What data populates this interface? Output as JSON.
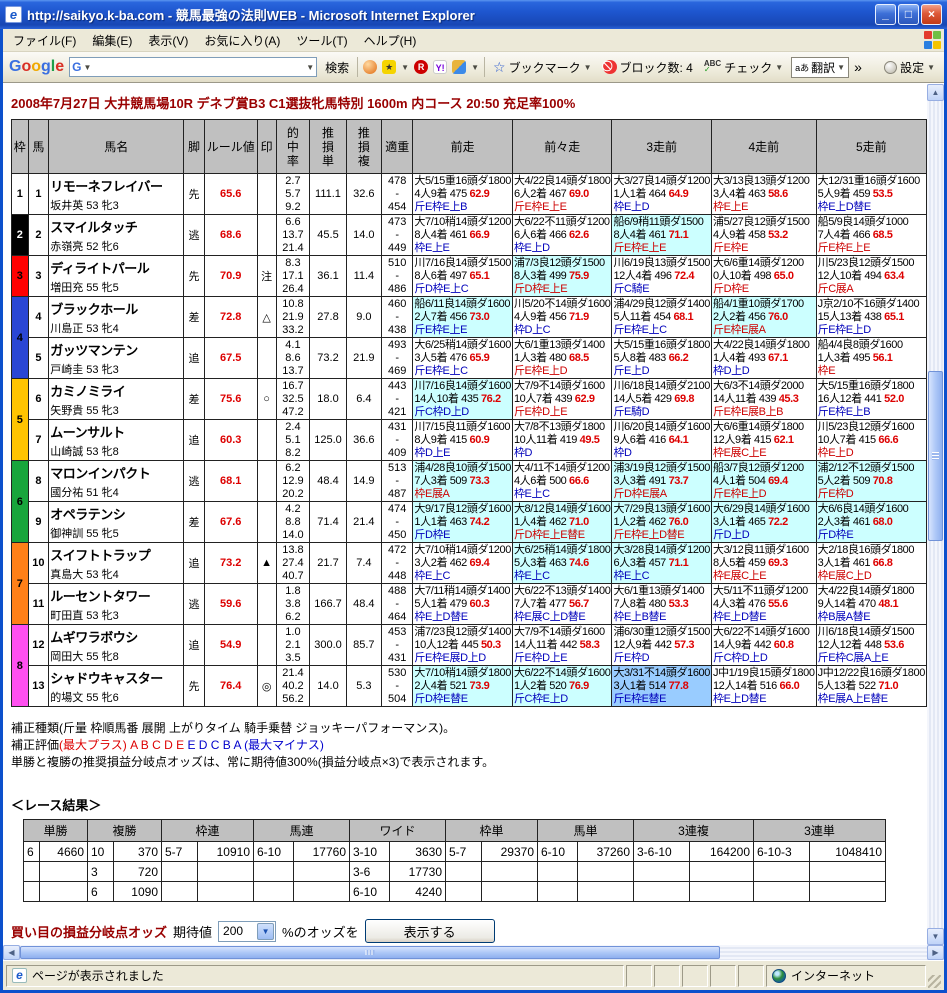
{
  "window": {
    "title": "http://saikyo.k-ba.com - 競馬最強の法則WEB - Microsoft Internet Explorer",
    "menus": [
      "ファイル(F)",
      "編集(E)",
      "表示(V)",
      "お気に入り(A)",
      "ツール(T)",
      "ヘルプ(H)"
    ],
    "status_left": "ページが表示されました",
    "status_right": "インターネット"
  },
  "toolbar": {
    "brand": "Google",
    "search_placeholder": "",
    "search_label": "検索",
    "bookmark_label": "ブックマーク",
    "block_label": "ブロック数: 4",
    "check_label": "チェック",
    "check_abc": "ABC",
    "translate_label": "翻訳",
    "translate_glyph": "aあ",
    "more_glyph": "»",
    "settings_label": "設定"
  },
  "page": {
    "race_title": "2008年7月27日 大井競馬場10R デネブ賞B3 C1選抜牝馬特別 1600m 内コース 20:50 充足率100%",
    "table_headers": [
      "枠",
      "馬",
      "馬名",
      "脚",
      "ルール値",
      "印",
      "的\n中\n率",
      "推\n損\n単",
      "推\n損\n複",
      "適重",
      "前走",
      "前々走",
      "3走前",
      "4走前",
      "5走前"
    ]
  },
  "horses": [
    {
      "frame": {
        "label": "1",
        "span": 1,
        "bg": "#ffffff",
        "fg": "#000000"
      },
      "num": "1",
      "name": "リモーネフレイバー",
      "jockey": "坂井英 53 牝3",
      "leg": "先",
      "rule": "65.6",
      "mark": "",
      "hit": [
        "2.7",
        "5.7",
        "9.2"
      ],
      "loss_win": "111.1",
      "loss_place": "32.6",
      "wt_hi": "478",
      "wt_lo": "454",
      "races": [
        {
          "t": "大5/15重16頭ダ1800",
          "res": "4人9着 475",
          "val": "62.9",
          "corr": "斤E枠E上B",
          "cc": "b",
          "bg": "w"
        },
        {
          "t": "大4/22良14頭ダ1800",
          "res": "6人2着 467",
          "val": "69.0",
          "corr": "斤E枠E上E",
          "cc": "r",
          "bg": "w"
        },
        {
          "t": "大3/27良14頭ダ1200",
          "res": "1人1着 464",
          "val": "64.9",
          "corr": "枠E上D",
          "cc": "b",
          "bg": "w"
        },
        {
          "t": "大3/13良13頭ダ1200",
          "res": "3人4着 463",
          "val": "58.6",
          "corr": "枠E上E",
          "cc": "r",
          "bg": "w"
        },
        {
          "t": "大12/31重16頭ダ1600",
          "res": "5人9着 459",
          "val": "53.5",
          "corr": "枠E上D替E",
          "cc": "b",
          "bg": "w"
        }
      ]
    },
    {
      "frame": {
        "label": "2",
        "span": 1,
        "bg": "#000000",
        "fg": "#ffffff"
      },
      "num": "2",
      "name": "スマイルタッチ",
      "jockey": "赤嶺亮 52 牝6",
      "leg": "逃",
      "rule": "68.6",
      "mark": "",
      "hit": [
        "6.6",
        "13.7",
        "21.4"
      ],
      "loss_win": "45.5",
      "loss_place": "14.0",
      "wt_hi": "473",
      "wt_lo": "449",
      "races": [
        {
          "t": "大7/10稍14頭ダ1200",
          "res": "8人4着 461",
          "val": "66.9",
          "corr": "枠E上E",
          "cc": "b",
          "bg": "w"
        },
        {
          "t": "大6/22不11頭ダ1200",
          "res": "6人6着 466",
          "val": "62.6",
          "corr": "枠E上D",
          "cc": "b",
          "bg": "w"
        },
        {
          "t": "船6/9稍11頭ダ1500",
          "res": "8人4着 461",
          "val": "71.1",
          "corr": "斤E枠E上E",
          "cc": "r",
          "bg": "c"
        },
        {
          "t": "浦5/27良12頭ダ1500",
          "res": "4人9着 458",
          "val": "53.2",
          "corr": "斤E枠E",
          "cc": "r",
          "bg": "w"
        },
        {
          "t": "船5/9良14頭ダ1000",
          "res": "7人4着 466",
          "val": "68.5",
          "corr": "斤E枠E上E",
          "cc": "r",
          "bg": "w"
        }
      ]
    },
    {
      "frame": {
        "label": "3",
        "span": 1,
        "bg": "#ff0000",
        "fg": "#000000"
      },
      "num": "3",
      "name": "ディライトパール",
      "jockey": "増田充 55 牝5",
      "leg": "先",
      "rule": "70.9",
      "mark": "注",
      "hit": [
        "8.3",
        "17.1",
        "26.4"
      ],
      "loss_win": "36.1",
      "loss_place": "11.4",
      "wt_hi": "510",
      "wt_lo": "486",
      "races": [
        {
          "t": "川7/16良14頭ダ1500",
          "res": "8人6着 497",
          "val": "65.1",
          "corr": "斤D枠E上C",
          "cc": "b",
          "bg": "w"
        },
        {
          "t": "浦7/3良12頭ダ1500",
          "res": "8人3着 499",
          "val": "75.9",
          "corr": "斤D枠E上E",
          "cc": "r",
          "bg": "c"
        },
        {
          "t": "川6/19良13頭ダ1500",
          "res": "12人4着 496",
          "val": "72.4",
          "corr": "斤C騎E",
          "cc": "b",
          "bg": "w"
        },
        {
          "t": "大6/6重14頭ダ1200",
          "res": "0人10着 498",
          "val": "65.0",
          "corr": "斤D枠E",
          "cc": "r",
          "bg": "w"
        },
        {
          "t": "川5/23良12頭ダ1500",
          "res": "12人10着 494",
          "val": "63.4",
          "corr": "斤C展A",
          "cc": "r",
          "bg": "w"
        }
      ]
    },
    {
      "frame": {
        "label": "4",
        "span": 2,
        "bg": "#2a46d4",
        "fg": "#000000"
      },
      "num": "4",
      "name": "ブラックホール",
      "jockey": "川島正 53 牝4",
      "leg": "差",
      "rule": "72.8",
      "mark": "△",
      "hit": [
        "10.8",
        "21.9",
        "33.2"
      ],
      "loss_win": "27.8",
      "loss_place": "9.0",
      "wt_hi": "460",
      "wt_lo": "438",
      "races": [
        {
          "t": "船6/11良14頭ダ1600",
          "res": "2人7着 456",
          "val": "73.0",
          "corr": "斤E枠E上E",
          "cc": "b",
          "bg": "c"
        },
        {
          "t": "川5/20不14頭ダ1600",
          "res": "4人9着 456",
          "val": "71.9",
          "corr": "枠D上C",
          "cc": "b",
          "bg": "w"
        },
        {
          "t": "浦4/29良12頭ダ1400",
          "res": "5人11着 454",
          "val": "68.1",
          "corr": "斤E枠E上C",
          "cc": "b",
          "bg": "w"
        },
        {
          "t": "船4/1重10頭ダ1700",
          "res": "2人2着 456",
          "val": "76.0",
          "corr": "斤E枠E展A",
          "cc": "r",
          "bg": "c"
        },
        {
          "t": "J京2/10不16頭ダ1400",
          "res": "15人13着 438",
          "val": "65.1",
          "corr": "斤E枠E上D",
          "cc": "b",
          "bg": "w"
        }
      ]
    },
    {
      "num": "5",
      "name": "ガッツマンテン",
      "jockey": "戸崎圭 53 牝3",
      "leg": "追",
      "rule": "67.5",
      "mark": "",
      "hit": [
        "4.1",
        "8.6",
        "13.7"
      ],
      "loss_win": "73.2",
      "loss_place": "21.9",
      "wt_hi": "493",
      "wt_lo": "469",
      "races": [
        {
          "t": "大6/25稍14頭ダ1600",
          "res": "3人5着 476",
          "val": "65.9",
          "corr": "斤E枠E上C",
          "cc": "b",
          "bg": "w"
        },
        {
          "t": "大6/1重13頭ダ1400",
          "res": "1人3着 480",
          "val": "68.5",
          "corr": "斤E枠E上D",
          "cc": "r",
          "bg": "w"
        },
        {
          "t": "大5/15重16頭ダ1800",
          "res": "5人8着 483",
          "val": "66.2",
          "corr": "斤E上D",
          "cc": "b",
          "bg": "w"
        },
        {
          "t": "大4/22良14頭ダ1800",
          "res": "1人4着 493",
          "val": "67.1",
          "corr": "枠D上D",
          "cc": "b",
          "bg": "w"
        },
        {
          "t": "船4/4良8頭ダ1600",
          "res": "1人3着 495",
          "val": "56.1",
          "corr": "枠E",
          "cc": "r",
          "bg": "w"
        }
      ]
    },
    {
      "frame": {
        "label": "5",
        "span": 2,
        "bg": "#ffc400",
        "fg": "#000000"
      },
      "num": "6",
      "name": "カミノミライ",
      "jockey": "矢野貴 55 牝3",
      "leg": "差",
      "rule": "75.6",
      "mark": "○",
      "hit": [
        "16.7",
        "32.5",
        "47.2"
      ],
      "loss_win": "18.0",
      "loss_place": "6.4",
      "wt_hi": "443",
      "wt_lo": "421",
      "races": [
        {
          "t": "川7/16良14頭ダ1600",
          "res": "14人10着 435",
          "val": "76.2",
          "corr": "斤C枠D上D",
          "cc": "b",
          "bg": "c"
        },
        {
          "t": "大7/9不14頭ダ1600",
          "res": "10人7着 439",
          "val": "62.9",
          "corr": "斤E枠D上E",
          "cc": "r",
          "bg": "w"
        },
        {
          "t": "川6/18良14頭ダ2100",
          "res": "14人5着 429",
          "val": "69.8",
          "corr": "斤E騎D",
          "cc": "b",
          "bg": "w"
        },
        {
          "t": "大6/3不14頭ダ2000",
          "res": "14人11着 439",
          "val": "45.3",
          "corr": "斤E枠E展B上B",
          "cc": "r",
          "bg": "w"
        },
        {
          "t": "大5/15重16頭ダ1800",
          "res": "16人12着 441",
          "val": "52.0",
          "corr": "斤E枠E上B",
          "cc": "b",
          "bg": "w"
        }
      ]
    },
    {
      "num": "7",
      "name": "ムーンサルト",
      "jockey": "山崎誠 53 牝8",
      "leg": "追",
      "rule": "60.3",
      "mark": "",
      "hit": [
        "2.4",
        "5.1",
        "8.2"
      ],
      "loss_win": "125.0",
      "loss_place": "36.6",
      "wt_hi": "431",
      "wt_lo": "409",
      "races": [
        {
          "t": "川7/15良11頭ダ1600",
          "res": "8人9着 415",
          "val": "60.9",
          "corr": "枠D上E",
          "cc": "b",
          "bg": "w"
        },
        {
          "t": "大7/8不13頭ダ1800",
          "res": "10人11着 419",
          "val": "49.5",
          "corr": "枠D",
          "cc": "b",
          "bg": "w"
        },
        {
          "t": "川6/20良14頭ダ1600",
          "res": "9人6着 416",
          "val": "64.1",
          "corr": "枠D",
          "cc": "b",
          "bg": "w"
        },
        {
          "t": "大6/6重14頭ダ1800",
          "res": "12人9着 415",
          "val": "62.1",
          "corr": "枠E展C上E",
          "cc": "r",
          "bg": "w"
        },
        {
          "t": "川5/23良12頭ダ1600",
          "res": "10人7着 415",
          "val": "66.6",
          "corr": "枠E上D",
          "cc": "r",
          "bg": "w"
        }
      ]
    },
    {
      "frame": {
        "label": "6",
        "span": 2,
        "bg": "#18a53c",
        "fg": "#000000"
      },
      "num": "8",
      "name": "マロンインパクト",
      "jockey": "國分祐 51 牝4",
      "leg": "逃",
      "rule": "68.1",
      "mark": "",
      "hit": [
        "6.2",
        "12.9",
        "20.2"
      ],
      "loss_win": "48.4",
      "loss_place": "14.9",
      "wt_hi": "513",
      "wt_lo": "487",
      "races": [
        {
          "t": "浦4/28良10頭ダ1500",
          "res": "7人3着 509",
          "val": "73.3",
          "corr": "枠E展A",
          "cc": "r",
          "bg": "c"
        },
        {
          "t": "大4/11不14頭ダ1200",
          "res": "4人6着 500",
          "val": "66.6",
          "corr": "枠E上C",
          "cc": "b",
          "bg": "w"
        },
        {
          "t": "浦3/19良12頭ダ1500",
          "res": "3人3着 491",
          "val": "73.7",
          "corr": "斤D枠E展A",
          "cc": "r",
          "bg": "c"
        },
        {
          "t": "船3/7良12頭ダ1200",
          "res": "4人1着 504",
          "val": "69.4",
          "corr": "斤E枠E上D",
          "cc": "r",
          "bg": "c"
        },
        {
          "t": "浦2/12不12頭ダ1500",
          "res": "5人2着 509",
          "val": "70.8",
          "corr": "斤E枠D",
          "cc": "r",
          "bg": "c"
        }
      ]
    },
    {
      "num": "9",
      "name": "オペラテンシ",
      "jockey": "御神訓 55 牝5",
      "leg": "差",
      "rule": "67.6",
      "mark": "",
      "hit": [
        "4.2",
        "8.8",
        "14.0"
      ],
      "loss_win": "71.4",
      "loss_place": "21.4",
      "wt_hi": "474",
      "wt_lo": "450",
      "races": [
        {
          "t": "大9/17良12頭ダ1600",
          "res": "1人1着 463",
          "val": "74.2",
          "corr": "斤D枠E",
          "cc": "b",
          "bg": "c"
        },
        {
          "t": "大8/12良14頭ダ1600",
          "res": "1人4着 462",
          "val": "71.0",
          "corr": "斤D枠E上E替E",
          "cc": "r",
          "bg": "c"
        },
        {
          "t": "大7/29良13頭ダ1600",
          "res": "1人2着 462",
          "val": "76.0",
          "corr": "斤E枠E上D替E",
          "cc": "r",
          "bg": "c"
        },
        {
          "t": "大6/29良14頭ダ1600",
          "res": "3人1着 465",
          "val": "72.2",
          "corr": "斤D上D",
          "cc": "b",
          "bg": "c"
        },
        {
          "t": "大6/6良14頭ダ1600",
          "res": "2人3着 461",
          "val": "68.0",
          "corr": "斤D枠E",
          "cc": "b",
          "bg": "c"
        }
      ]
    },
    {
      "frame": {
        "label": "7",
        "span": 2,
        "bg": "#ff8018",
        "fg": "#000000"
      },
      "num": "10",
      "name": "スイフトトラップ",
      "jockey": "真島大 53 牝4",
      "leg": "追",
      "rule": "73.2",
      "mark": "▲",
      "hit": [
        "13.8",
        "27.4",
        "40.7"
      ],
      "loss_win": "21.7",
      "loss_place": "7.4",
      "wt_hi": "472",
      "wt_lo": "448",
      "races": [
        {
          "t": "大7/10稍14頭ダ1200",
          "res": "3人2着 462",
          "val": "69.4",
          "corr": "枠E上C",
          "cc": "b",
          "bg": "w"
        },
        {
          "t": "大6/25稍14頭ダ1800",
          "res": "5人3着 463",
          "val": "74.6",
          "corr": "枠E上C",
          "cc": "b",
          "bg": "c"
        },
        {
          "t": "大3/28良14頭ダ1200",
          "res": "6人3着 457",
          "val": "71.1",
          "corr": "枠E上C",
          "cc": "b",
          "bg": "c"
        },
        {
          "t": "大3/12良11頭ダ1600",
          "res": "8人5着 459",
          "val": "69.3",
          "corr": "枠E展C上E",
          "cc": "r",
          "bg": "w"
        },
        {
          "t": "大2/18良16頭ダ1800",
          "res": "3人1着 461",
          "val": "66.8",
          "corr": "枠E展C上D",
          "cc": "r",
          "bg": "w"
        }
      ]
    },
    {
      "num": "11",
      "name": "ルーセントタワー",
      "jockey": "町田直 53 牝3",
      "leg": "逃",
      "rule": "59.6",
      "mark": "",
      "hit": [
        "1.8",
        "3.8",
        "6.2"
      ],
      "loss_win": "166.7",
      "loss_place": "48.4",
      "wt_hi": "488",
      "wt_lo": "464",
      "races": [
        {
          "t": "大7/11稍14頭ダ1400",
          "res": "5人1着 479",
          "val": "60.3",
          "corr": "枠E上D替E",
          "cc": "b",
          "bg": "w"
        },
        {
          "t": "大6/22不13頭ダ1400",
          "res": "7人7着 477",
          "val": "56.7",
          "corr": "枠E展C上D替E",
          "cc": "b",
          "bg": "w"
        },
        {
          "t": "大6/1重13頭ダ1400",
          "res": "7人8着 480",
          "val": "53.3",
          "corr": "枠E上B替E",
          "cc": "b",
          "bg": "w"
        },
        {
          "t": "大5/11不11頭ダ1200",
          "res": "4人3着 476",
          "val": "55.6",
          "corr": "枠E上D替E",
          "cc": "b",
          "bg": "w"
        },
        {
          "t": "大4/22良14頭ダ1800",
          "res": "9人14着 470",
          "val": "48.1",
          "corr": "枠B展A替E",
          "cc": "b",
          "bg": "w"
        }
      ]
    },
    {
      "frame": {
        "label": "8",
        "span": 2,
        "bg": "#ff50f0",
        "fg": "#000000"
      },
      "num": "12",
      "name": "ムギワラボウシ",
      "jockey": "岡田大 55 牝8",
      "leg": "追",
      "rule": "54.9",
      "mark": "",
      "hit": [
        "1.0",
        "2.1",
        "3.5"
      ],
      "loss_win": "300.0",
      "loss_place": "85.7",
      "wt_hi": "453",
      "wt_lo": "431",
      "races": [
        {
          "t": "浦7/23良12頭ダ1400",
          "res": "10人12着 445",
          "val": "50.3",
          "corr": "斤E枠E展D上D",
          "cc": "b",
          "bg": "w"
        },
        {
          "t": "大7/9不14頭ダ1600",
          "res": "14人11着 442",
          "val": "58.3",
          "corr": "斤E枠D上E",
          "cc": "b",
          "bg": "w"
        },
        {
          "t": "浦6/30重12頭ダ1500",
          "res": "12人9着 442",
          "val": "57.3",
          "corr": "斤E枠D",
          "cc": "b",
          "bg": "w"
        },
        {
          "t": "大6/22不14頭ダ1600",
          "res": "14人9着 442",
          "val": "60.8",
          "corr": "斤C枠D上D",
          "cc": "b",
          "bg": "w"
        },
        {
          "t": "川6/18良14頭ダ1500",
          "res": "12人12着 448",
          "val": "53.6",
          "corr": "斤E枠C展A上E",
          "cc": "b",
          "bg": "w"
        }
      ]
    },
    {
      "num": "13",
      "name": "シャドウキャスター",
      "jockey": "的場文 55 牝6",
      "leg": "先",
      "rule": "76.4",
      "mark": "◎",
      "hit": [
        "21.4",
        "40.2",
        "56.2"
      ],
      "loss_win": "14.0",
      "loss_place": "5.3",
      "wt_hi": "530",
      "wt_lo": "504",
      "races": [
        {
          "t": "大7/10稍14頭ダ1800",
          "res": "2人4着 521",
          "val": "73.9",
          "corr": "斤D枠E替E",
          "cc": "b",
          "bg": "c"
        },
        {
          "t": "大6/22不14頭ダ1600",
          "res": "1人2着 520",
          "val": "76.9",
          "corr": "斤C枠E上D",
          "cc": "b",
          "bg": "c"
        },
        {
          "t": "大3/31不14頭ダ1600",
          "res": "3人1着 514",
          "val": "77.8",
          "corr": "斤E枠E替E",
          "cc": "b",
          "bg": "h"
        },
        {
          "t": "J中1/19良15頭ダ1800",
          "res": "12人14着 516",
          "val": "66.0",
          "corr": "枠E上D替E",
          "cc": "b",
          "bg": "w"
        },
        {
          "t": "J中12/22良16頭ダ1800",
          "res": "5人13着 522",
          "val": "71.0",
          "corr": "枠E展A上E替E",
          "cc": "b",
          "bg": "w"
        }
      ]
    }
  ],
  "notes": {
    "line1": "補正種類(斤量 枠順馬番 展開 上がりタイム 騎手乗替 ジョッキーパフォーマンス)。",
    "line2_black": "補正評価",
    "line2_red": "(最大プラス)  A  B  C  D  E",
    "line2_blue": "  E  D  C  B  A  (最大マイナス)",
    "line3": "単勝と複勝の推奨損益分岐点オッズは、常に期待値300%(損益分岐点×3)で表示されます。"
  },
  "results": {
    "title": "＜レース結果＞",
    "headers": [
      "単勝",
      "複勝",
      "枠連",
      "馬連",
      "ワイド",
      "枠単",
      "馬単",
      "3連複",
      "3連単"
    ],
    "rows": [
      [
        [
          "6",
          "4660"
        ],
        [
          "10",
          "370"
        ],
        [
          "5-7",
          "10910"
        ],
        [
          "6-10",
          "17760"
        ],
        [
          "3-10",
          "3630"
        ],
        [
          "5-7",
          "29370"
        ],
        [
          "6-10",
          "37260"
        ],
        [
          "3-6-10",
          "164200"
        ],
        [
          "6-10-3",
          "1048410"
        ]
      ],
      [
        [
          "",
          ""
        ],
        [
          "3",
          "720"
        ],
        [
          "",
          ""
        ],
        [
          "",
          ""
        ],
        [
          "3-6",
          "17730"
        ],
        [
          "",
          ""
        ],
        [
          "",
          ""
        ],
        [
          "",
          ""
        ],
        [
          "",
          ""
        ]
      ],
      [
        [
          "",
          ""
        ],
        [
          "6",
          "1090"
        ],
        [
          "",
          ""
        ],
        [
          "",
          ""
        ],
        [
          "6-10",
          "4240"
        ],
        [
          "",
          ""
        ],
        [
          "",
          ""
        ],
        [
          "",
          ""
        ],
        [
          "",
          ""
        ]
      ]
    ]
  },
  "controls": {
    "label": "買い目の損益分岐点オッズ",
    "pre_text": "期待値",
    "select_value": "200",
    "post_text": "%のオッズを",
    "button_label": "表示する"
  }
}
